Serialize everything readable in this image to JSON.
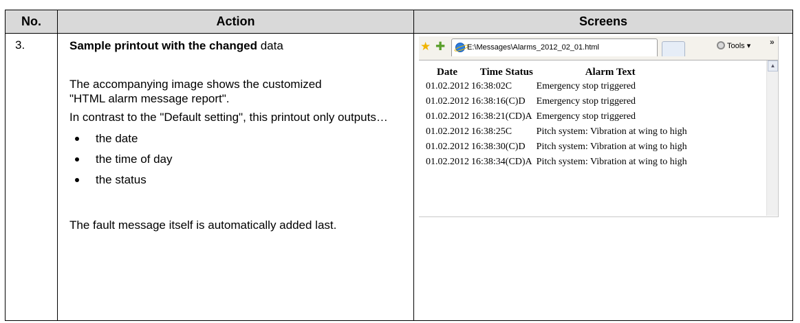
{
  "table": {
    "headers": [
      "No.",
      "Action",
      "Screens"
    ],
    "step_number": "3.",
    "action": {
      "heading_bold": "Sample printout with the changed",
      "heading_normal": " data",
      "para1": "The accompanying image shows the customized",
      "para1b": "\"HTML alarm message report\".",
      "para2": "In contrast to the \"Default setting\", this printout only outputs…",
      "bullets": [
        "the date",
        "the time of day",
        "the status"
      ],
      "para3": "The fault message itself is automatically added last."
    }
  },
  "browser": {
    "tab_title": "E:\\Messages\\Alarms_2012_02_01.html",
    "tools_label": "Tools",
    "tools_arrow": "▾",
    "overflow_chevron": "»",
    "icons": [
      "favorites-star-icon",
      "add-favorite-icon",
      "ie-page-icon",
      "gear-icon"
    ],
    "report": {
      "columns": [
        "Date",
        "Time",
        "Status",
        "Alarm Text"
      ],
      "rows": [
        {
          "date": "01.02.2012",
          "time": "16:38:02",
          "status": "C",
          "text": "Emergency stop triggered"
        },
        {
          "date": "01.02.2012",
          "time": "16:38:16",
          "status": "(C)D",
          "text": "Emergency stop triggered"
        },
        {
          "date": "01.02.2012",
          "time": "16:38:21",
          "status": "(CD)A",
          "text": "Emergency stop triggered"
        },
        {
          "date": "01.02.2012",
          "time": "16:38:25",
          "status": "C",
          "text": "Pitch system: Vibration at wing to high"
        },
        {
          "date": "01.02.2012",
          "time": "16:38:30",
          "status": "(C)D",
          "text": "Pitch system: Vibration at wing to high"
        },
        {
          "date": "01.02.2012",
          "time": "16:38:34",
          "status": "(CD)A",
          "text": "Pitch system: Vibration at wing to high"
        }
      ]
    }
  }
}
